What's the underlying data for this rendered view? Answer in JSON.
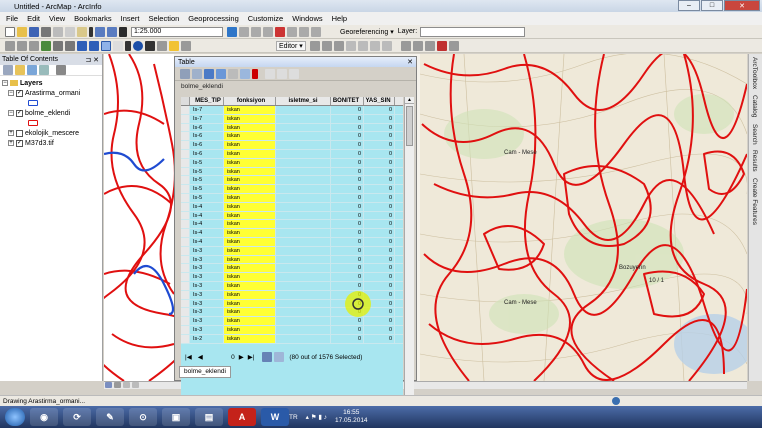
{
  "window": {
    "title": "Untitled - ArcMap - ArcInfo",
    "controls": [
      "–",
      "□",
      "✕"
    ]
  },
  "menu": [
    "File",
    "Edit",
    "View",
    "Bookmarks",
    "Insert",
    "Selection",
    "Geoprocessing",
    "Customize",
    "Windows",
    "Help"
  ],
  "toolbar": {
    "scale_value": "1:25.000",
    "editor_label": "Editor ▾",
    "georeferencing_label": "Georeferencing ▾",
    "layer_label": "Layer:"
  },
  "toc": {
    "title": "Table Of Contents",
    "pin": "⊐ ✕",
    "root": "Layers",
    "layers": [
      {
        "name": "Arastirma_ormani",
        "checked": true,
        "color": "#1f4bd1"
      },
      {
        "name": "bolme_eklendi",
        "checked": true,
        "color": "#e01010"
      },
      {
        "name": "ekolojik_mescere",
        "checked": false,
        "color": ""
      },
      {
        "name": "M37d3.tif",
        "checked": true,
        "color": ""
      }
    ]
  },
  "right_tabs": [
    "ArcToolbox",
    "Catalog",
    "Search",
    "Results",
    "Create Features"
  ],
  "map_labels": [
    "Cam - Mese",
    "Bozuyerin",
    "10 / 1",
    "Cam - Mese"
  ],
  "table": {
    "title": "Table",
    "close": "✕",
    "layer_tab": "bolme_eklendi",
    "columns": [
      "MES_TIP",
      "fonksiyon",
      "isletme_si",
      "BONITET",
      "YAS_SIN"
    ],
    "rows": [
      [
        "Is-7",
        "iskan",
        "",
        "0",
        "0"
      ],
      [
        "Is-7",
        "iskan",
        "",
        "0",
        "0"
      ],
      [
        "Is-6",
        "iskan",
        "",
        "0",
        "0"
      ],
      [
        "Is-6",
        "iskan",
        "",
        "0",
        "0"
      ],
      [
        "Is-6",
        "iskan",
        "",
        "0",
        "0"
      ],
      [
        "Is-6",
        "iskan",
        "",
        "0",
        "0"
      ],
      [
        "Is-5",
        "iskan",
        "",
        "0",
        "0"
      ],
      [
        "Is-5",
        "iskan",
        "",
        "0",
        "0"
      ],
      [
        "Is-5",
        "iskan",
        "",
        "0",
        "0"
      ],
      [
        "Is-5",
        "iskan",
        "",
        "0",
        "0"
      ],
      [
        "Is-5",
        "iskan",
        "",
        "0",
        "0"
      ],
      [
        "Is-4",
        "iskan",
        "",
        "0",
        "0"
      ],
      [
        "Is-4",
        "iskan",
        "",
        "0",
        "0"
      ],
      [
        "Is-4",
        "iskan",
        "",
        "0",
        "0"
      ],
      [
        "Is-4",
        "iskan",
        "",
        "0",
        "0"
      ],
      [
        "Is-4",
        "iskan",
        "",
        "0",
        "0"
      ],
      [
        "Is-3",
        "iskan",
        "",
        "0",
        "0"
      ],
      [
        "Is-3",
        "iskan",
        "",
        "0",
        "0"
      ],
      [
        "Is-3",
        "iskan",
        "",
        "0",
        "0"
      ],
      [
        "Is-3",
        "iskan",
        "",
        "0",
        "0"
      ],
      [
        "Is-3",
        "iskan",
        "",
        "0",
        "0"
      ],
      [
        "Is-3",
        "iskan",
        "",
        "0",
        "0"
      ],
      [
        "Is-3",
        "iskan",
        "",
        "0",
        "0"
      ],
      [
        "Is-3",
        "iskan",
        "",
        "0",
        "0"
      ],
      [
        "Is-3",
        "iskan",
        "",
        "0",
        "0"
      ],
      [
        "Is-3",
        "iskan",
        "",
        "0",
        "0"
      ],
      [
        "Is-2",
        "iskan",
        "",
        "0",
        "0"
      ]
    ],
    "nav_record": "0",
    "selection_text": "(80 out of 1576 Selected)"
  },
  "status": {
    "text": "Drawing Arastirma_ormani..."
  },
  "taskbar": {
    "apps": [
      "◉",
      "⟳",
      "✎",
      "⊙",
      "▣",
      "▤",
      "A",
      "W"
    ],
    "lang": "TR",
    "time": "16:55",
    "date": "17.05.2014"
  },
  "colors": {
    "boundary": "#e01010",
    "highlight": "#ffff33",
    "grid_bg": "#a8e6f0"
  }
}
